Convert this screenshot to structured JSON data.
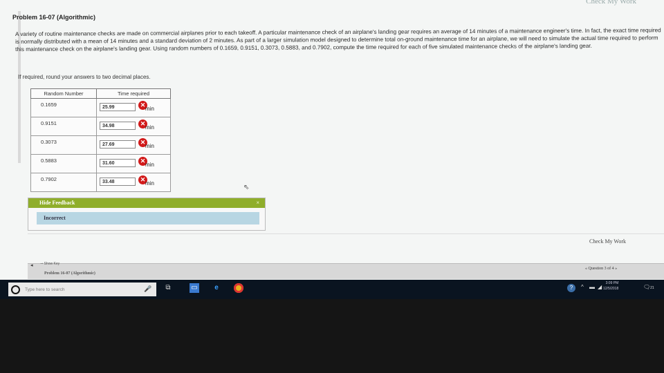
{
  "page": {
    "top_right_label": "Check My Work",
    "title": "Problem 16-07 (Algorithmic)",
    "problem_text": "A variety of routine maintenance checks are made on commercial airplanes prior to each takeoff. A particular maintenance check of an airplane's landing gear requires an average of 14 minutes of a maintenance engineer's time. In fact, the exact time required is normally distributed with a mean of 14 minutes and a standard deviation of 2 minutes. As part of a larger simulation model designed to determine total on-ground maintenance time for an airplane, we will need to simulate the actual time required to perform this maintenance check on the airplane's landing gear. Using random numbers of 0.1659, 0.9151, 0.3073, 0.5883, and 0.7902, compute the time required for each of five simulated maintenance checks of the airplane's landing gear.",
    "instruction": "If required, round your answers to two decimal places."
  },
  "table": {
    "headers": [
      "Random Number",
      "Time required"
    ],
    "unit": "min",
    "rows": [
      {
        "random": "0.1659",
        "answer": "25.99"
      },
      {
        "random": "0.9151",
        "answer": "34.98"
      },
      {
        "random": "0.3073",
        "answer": "27.69"
      },
      {
        "random": "0.5883",
        "answer": "31.60"
      },
      {
        "random": "0.7902",
        "answer": "33.48"
      }
    ]
  },
  "feedback": {
    "header": "Hide Feedback",
    "close": "×",
    "message": "Incorrect"
  },
  "footer": {
    "check_my_work": "Check My Work",
    "show_key": "Show Key",
    "problem_link": "Problem 16-07 (Algorithmic)",
    "question_nav": "« Question 3 of 4 »"
  },
  "taskbar": {
    "search_placeholder": "Type here to search",
    "time": "3:09 PM",
    "date": "12/5/2018",
    "notification_count": "21"
  },
  "colors": {
    "feedback_header": "#8fae2b",
    "feedback_body": "#b8d6e3",
    "error_icon": "#d21a1a",
    "taskbar": "#0a1420"
  }
}
